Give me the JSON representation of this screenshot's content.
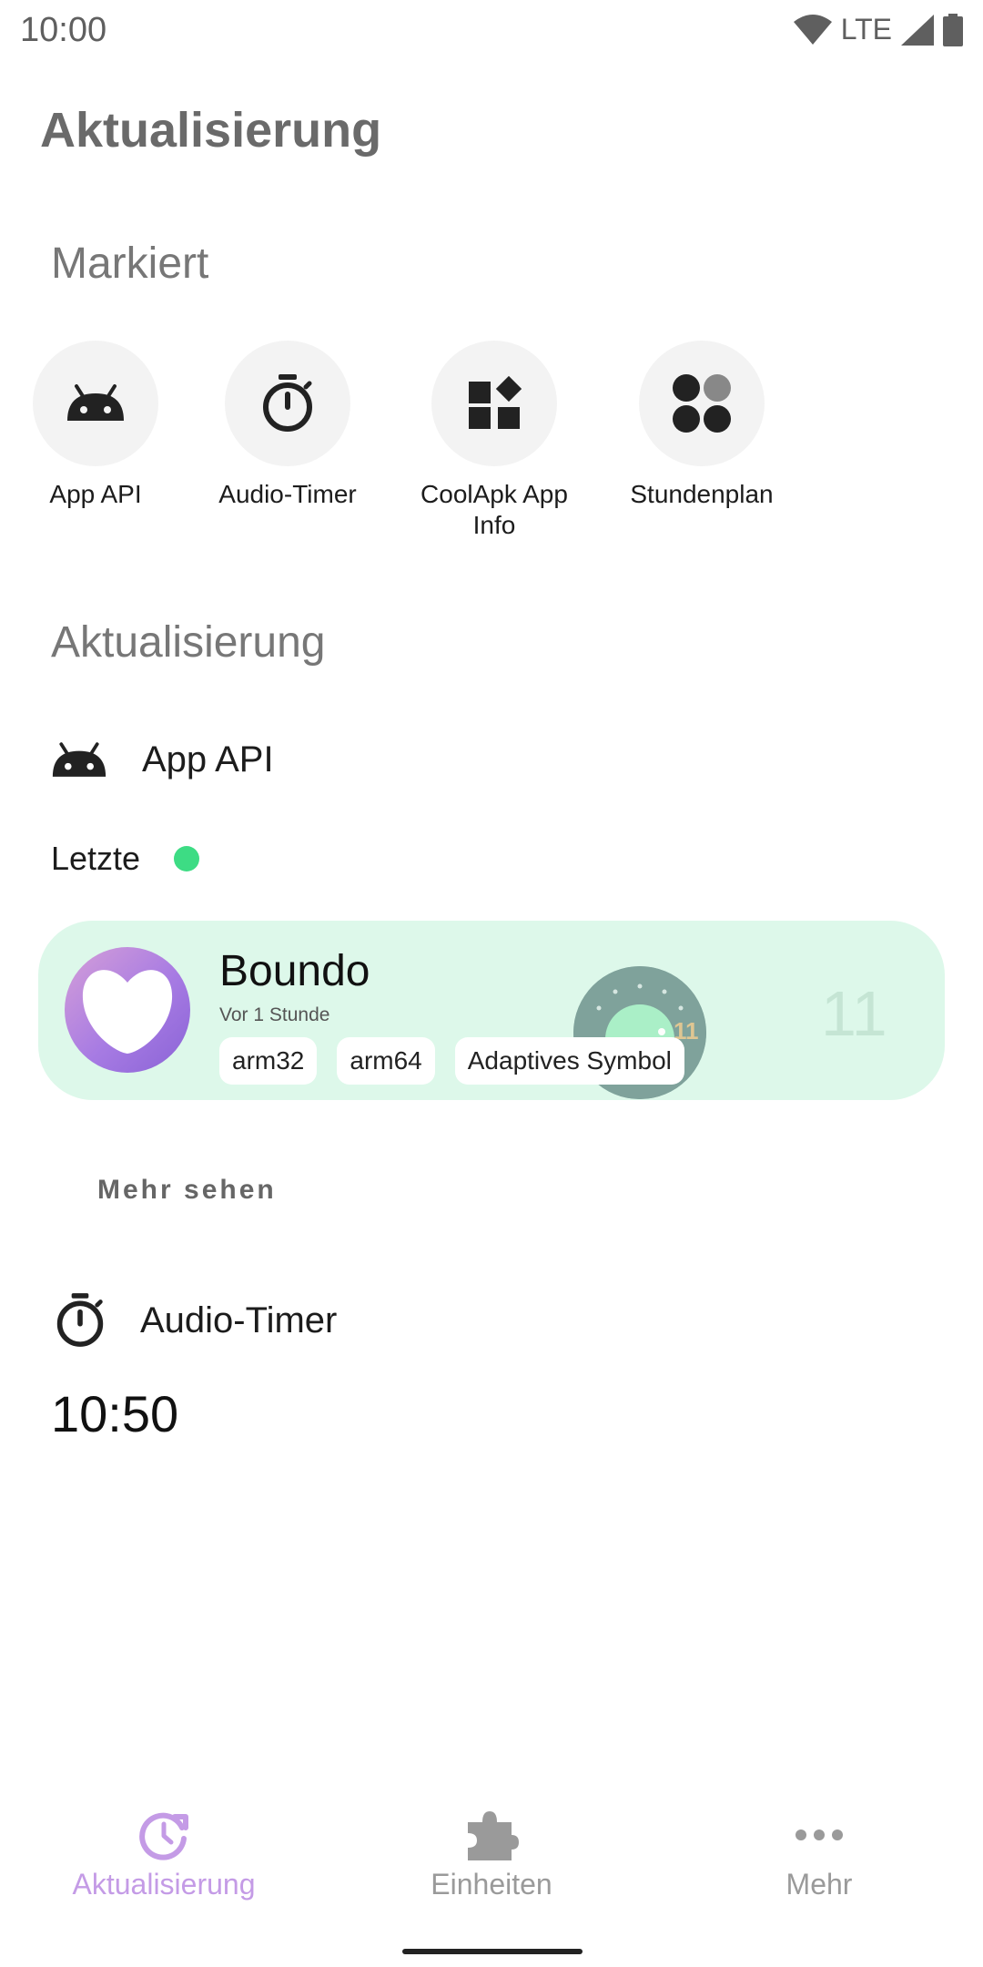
{
  "status_bar": {
    "time": "10:00",
    "network": "LTE"
  },
  "page_title": "Aktualisierung",
  "featured": {
    "title": "Markiert",
    "items": [
      {
        "label": "App API",
        "icon": "android-icon"
      },
      {
        "label": "Audio-Timer",
        "icon": "timer-icon"
      },
      {
        "label": "CoolApk App Info",
        "icon": "widgets-icon"
      },
      {
        "label": "Stundenplan",
        "icon": "dots-grid-icon"
      }
    ]
  },
  "updates": {
    "title": "Aktualisierung",
    "app_api": {
      "label": "App API",
      "recent_label": "Letzte",
      "card": {
        "app_name": "Boundo",
        "time_ago": "Vor 1 Stunde",
        "tags": [
          "arm32",
          "arm64",
          "Adaptives Symbol"
        ],
        "api_level": "11"
      },
      "more_link": "Mehr sehen"
    },
    "audio_timer": {
      "label": "Audio-Timer",
      "value": "10:50"
    }
  },
  "bottom_nav": {
    "items": [
      {
        "label": "Aktualisierung",
        "icon": "update-icon",
        "active": true
      },
      {
        "label": "Einheiten",
        "icon": "puzzle-icon",
        "active": false
      },
      {
        "label": "Mehr",
        "icon": "more-horiz-icon",
        "active": false
      }
    ]
  },
  "colors": {
    "accent": "#c49be6",
    "card_bg": "#ddf8ea",
    "status_dot": "#3ddc84",
    "inactive_nav": "#9a9a9a"
  }
}
